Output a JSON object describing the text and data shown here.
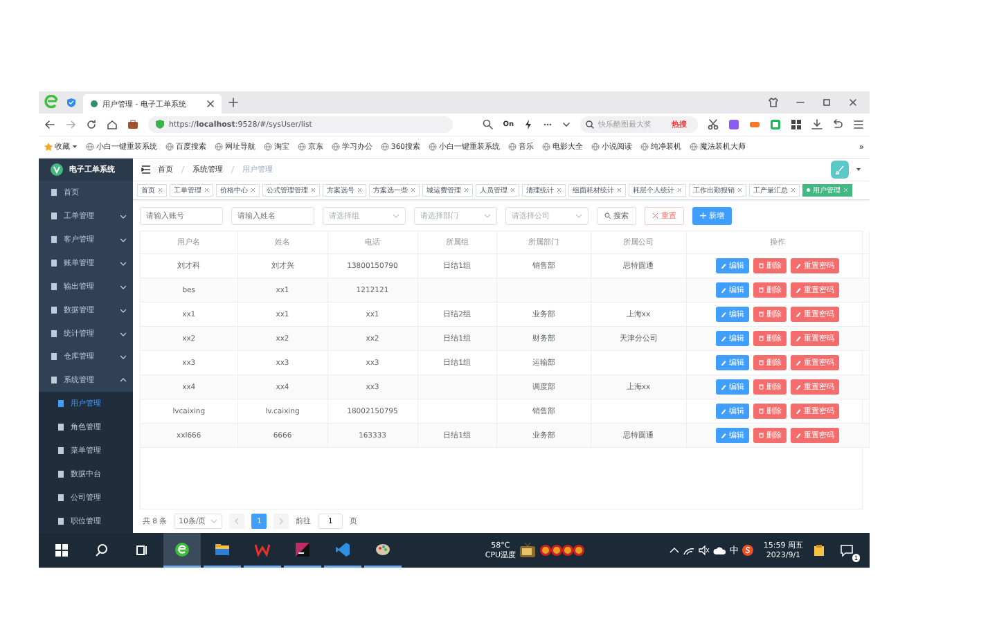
{
  "browser": {
    "tab_title": "用户管理 - 电子工单系统",
    "url": "https://**localhost**:9528/#/sysUser/list",
    "mode": "On",
    "search_placeholder": "快乐酷图最大奖",
    "hot": "热搜",
    "bookmarks": {
      "label": "收藏",
      "items": [
        "小白一键重装系统",
        "百度搜索",
        "网址导航",
        "淘宝",
        "京东",
        "学习办公",
        "360搜索",
        "小白一键重装系统",
        "音乐",
        "电影大全",
        "小说阅读",
        "纯净装机",
        "魔法装机大师"
      ],
      "more": "»"
    }
  },
  "app": {
    "logo": "电子工单系统",
    "sidebar": [
      {
        "label": "首页",
        "kind": "link",
        "selected": false
      },
      {
        "label": "工单管理",
        "kind": "group",
        "expanded": false,
        "selected": false
      },
      {
        "label": "客户管理",
        "kind": "group",
        "expanded": false,
        "selected": false
      },
      {
        "label": "账单管理",
        "kind": "group",
        "expanded": false,
        "selected": false
      },
      {
        "label": "输出管理",
        "kind": "group",
        "expanded": false,
        "selected": false
      },
      {
        "label": "数据管理",
        "kind": "group",
        "expanded": false,
        "selected": false
      },
      {
        "label": "统计管理",
        "kind": "group",
        "expanded": false,
        "selected": false
      },
      {
        "label": "仓库管理",
        "kind": "group",
        "expanded": false,
        "selected": false
      },
      {
        "label": "系统管理",
        "kind": "group",
        "expanded": true,
        "selected": false,
        "children": [
          {
            "label": "用户管理",
            "selected": true
          },
          {
            "label": "角色管理",
            "selected": false
          },
          {
            "label": "菜单管理",
            "selected": false
          },
          {
            "label": "数据中台",
            "selected": false
          },
          {
            "label": "公司管理",
            "selected": false
          },
          {
            "label": "职位管理",
            "selected": false
          }
        ]
      }
    ],
    "breadcrumb": [
      "首页",
      "系统管理",
      "用户管理"
    ],
    "tags": [
      {
        "label": "首页",
        "selected": false
      },
      {
        "label": "工单管理",
        "selected": false
      },
      {
        "label": "价格中心",
        "selected": false
      },
      {
        "label": "公式管理管理",
        "selected": false
      },
      {
        "label": "方案选号",
        "selected": false
      },
      {
        "label": "方案选一些",
        "selected": false
      },
      {
        "label": "城运费管理",
        "selected": false
      },
      {
        "label": "人员管理",
        "selected": false
      },
      {
        "label": "清理统计",
        "selected": false
      },
      {
        "label": "组面耗材统计",
        "selected": false
      },
      {
        "label": "耗层个人统计",
        "selected": false
      },
      {
        "label": "工作出勤报销",
        "selected": false
      },
      {
        "label": "工产量汇总",
        "selected": false
      },
      {
        "label": "用户管理",
        "selected": true
      }
    ],
    "filters": [
      {
        "kind": "input",
        "placeholder": "请输入账号"
      },
      {
        "kind": "input",
        "placeholder": "请输入姓名"
      },
      {
        "kind": "select",
        "placeholder": "请选择组"
      },
      {
        "kind": "select",
        "placeholder": "请选择部门"
      },
      {
        "kind": "select",
        "placeholder": "请选择公司"
      }
    ],
    "filter_buttons": [
      {
        "kind": "search",
        "label": "搜索"
      },
      {
        "kind": "reset",
        "label": "重置"
      },
      {
        "kind": "add",
        "label": "新增"
      }
    ],
    "table": {
      "columns": [
        "用户名",
        "姓名",
        "电话",
        "所属组",
        "所属部门",
        "所属公司",
        "操作"
      ],
      "rows": [
        {
          "cells": [
            "刘才科",
            "刘才兴",
            "13800150790",
            "日结1组",
            "销售部",
            "思特圆通"
          ],
          "actions": [
            {
              "kind": "edit",
              "label": "编辑"
            },
            {
              "kind": "delete",
              "label": "删除"
            },
            {
              "kind": "reset",
              "label": "重置密码"
            }
          ]
        },
        {
          "cells": [
            "bes",
            "xx1",
            "1212121",
            null,
            null,
            null
          ],
          "actions": [
            {
              "kind": "edit",
              "label": "编辑"
            },
            {
              "kind": "delete",
              "label": "删除"
            },
            {
              "kind": "reset",
              "label": "重置密码"
            }
          ]
        },
        {
          "cells": [
            "xx1",
            "xx1",
            "xx1",
            "日结2组",
            "业务部",
            "上海xx"
          ],
          "actions": [
            {
              "kind": "edit",
              "label": "编辑"
            },
            {
              "kind": "delete",
              "label": "删除"
            },
            {
              "kind": "reset",
              "label": "重置密码"
            }
          ]
        },
        {
          "cells": [
            "xx2",
            "xx2",
            "xx2",
            "日结1组",
            "财务部",
            "天津分公司"
          ],
          "actions": [
            {
              "kind": "edit",
              "label": "编辑"
            },
            {
              "kind": "delete",
              "label": "删除"
            },
            {
              "kind": "reset",
              "label": "重置密码"
            }
          ]
        },
        {
          "cells": [
            "xx3",
            "xx3",
            "xx3",
            "日结1组",
            "运输部",
            null
          ],
          "actions": [
            {
              "kind": "edit",
              "label": "编辑"
            },
            {
              "kind": "delete",
              "label": "删除"
            },
            {
              "kind": "reset",
              "label": "重置密码"
            }
          ]
        },
        {
          "cells": [
            "xx4",
            "xx4",
            "xx3",
            null,
            "调度部",
            "上海xx"
          ],
          "actions": [
            {
              "kind": "edit",
              "label": "编辑"
            },
            {
              "kind": "delete",
              "label": "删除"
            },
            {
              "kind": "reset",
              "label": "重置密码"
            }
          ]
        },
        {
          "cells": [
            "lvcaixing",
            "lv.caixing",
            "18002150795",
            null,
            "销售部",
            null
          ],
          "actions": [
            {
              "kind": "edit",
              "label": "编辑"
            },
            {
              "kind": "delete",
              "label": "删除"
            },
            {
              "kind": "reset",
              "label": "重置密码"
            }
          ]
        },
        {
          "cells": [
            "xxl666",
            "6666",
            "163333",
            "日结1组",
            "业务部",
            "思特圆通"
          ],
          "actions": [
            {
              "kind": "edit",
              "label": "编辑"
            },
            {
              "kind": "delete",
              "label": "删除"
            },
            {
              "kind": "reset",
              "label": "重置密码"
            }
          ]
        }
      ]
    },
    "pagination": {
      "total": "共 8 条",
      "page_size": "10条/页",
      "pages": [
        {
          "label": "1",
          "selected": true
        }
      ],
      "goto_label": "前往",
      "goto_value": "1",
      "goto_suffix": "页"
    }
  },
  "taskbar": {
    "apps": [
      {
        "kind": "browser",
        "selected": true
      },
      {
        "kind": "folder",
        "selected": false
      },
      {
        "kind": "wps",
        "selected": false
      },
      {
        "kind": "ide",
        "selected": false
      },
      {
        "kind": "vscode",
        "selected": false
      },
      {
        "kind": "paint",
        "selected": false
      }
    ],
    "temperature": "58°C",
    "sensor": "CPU温度",
    "ime": "中",
    "time": "15:59 周五",
    "date": "2023/9/1",
    "notifications": "1"
  }
}
